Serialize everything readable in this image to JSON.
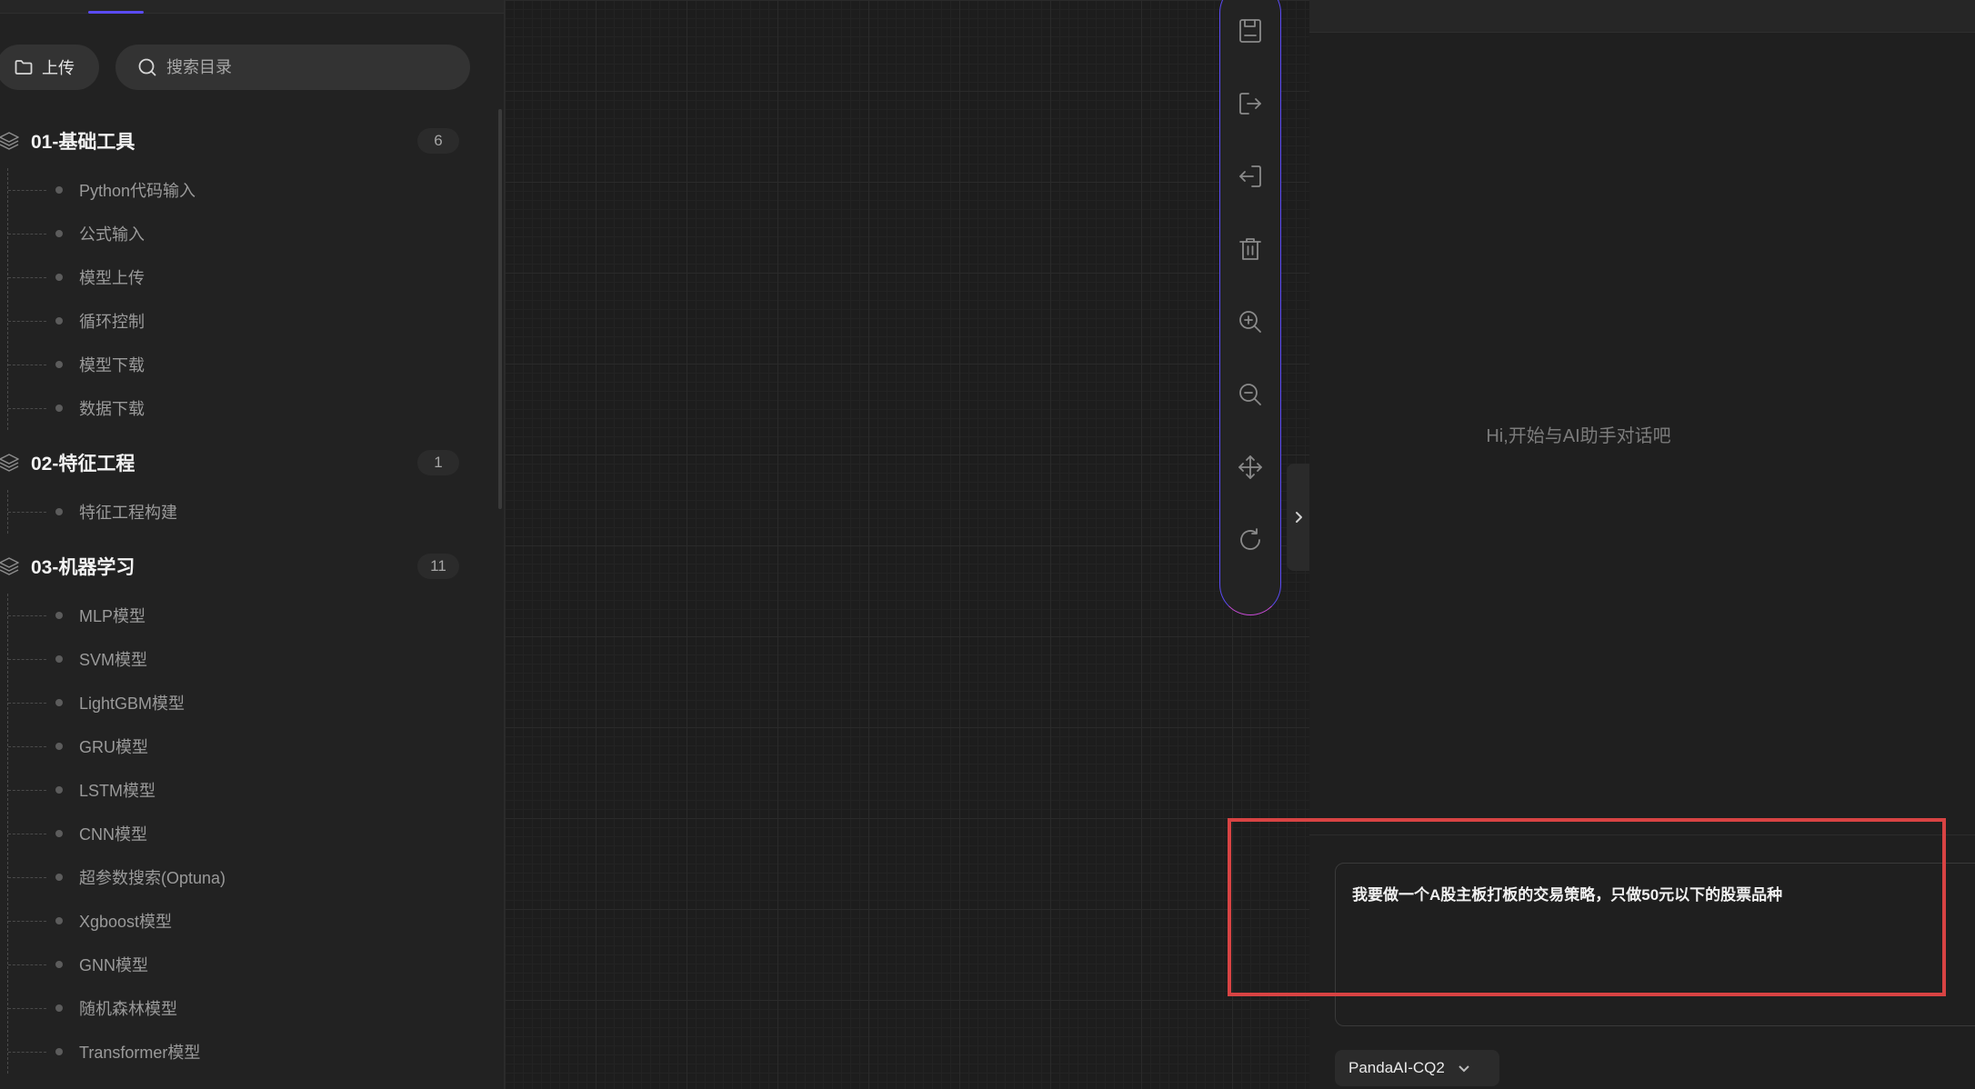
{
  "sidebar": {
    "upload_label": "上传",
    "search_placeholder": "搜索目录",
    "categories": [
      {
        "title": "01-基础工具",
        "count": "6",
        "items": [
          "Python代码输入",
          "公式输入",
          "模型上传",
          "循环控制",
          "模型下载",
          "数据下载"
        ]
      },
      {
        "title": "02-特征工程",
        "count": "1",
        "items": [
          "特征工程构建"
        ]
      },
      {
        "title": "03-机器学习",
        "count": "11",
        "items": [
          "MLP模型",
          "SVM模型",
          "LightGBM模型",
          "GRU模型",
          "LSTM模型",
          "CNN模型",
          "超参数搜索(Optuna)",
          "Xgboost模型",
          "GNN模型",
          "随机森林模型",
          "Transformer模型"
        ]
      }
    ]
  },
  "toolbar": {
    "buttons": [
      "save-icon",
      "export-icon",
      "import-icon",
      "delete-icon",
      "zoom-in-icon",
      "zoom-out-icon",
      "move-icon",
      "refresh-icon"
    ]
  },
  "ai_panel": {
    "empty_hint": "Hi,开始与AI助手对话吧",
    "input_text": "我要做一个A股主板打板的交易策略，只做50元以下的股票品种",
    "model_name": "PandaAI-CQ2"
  },
  "colors": {
    "accent": "#5b4bf5",
    "highlight": "#d84343",
    "toolbar_gradient_end": "#c94bd8"
  }
}
